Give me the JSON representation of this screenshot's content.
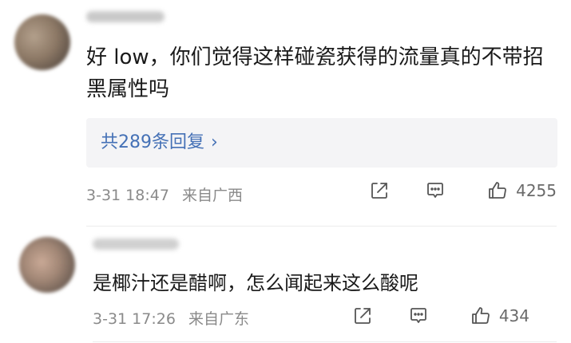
{
  "comments": [
    {
      "text": "好 low，你们觉得这样碰瓷获得的流量真的不带招黑属性吗",
      "reply_link": "共289条回复",
      "timestamp": "3-31 18:47",
      "location": "来自广西",
      "likes": "4255"
    },
    {
      "text": "是椰汁还是醋啊，怎么闻起来这么酸呢",
      "timestamp": "3-31 17:26",
      "location": "来自广东",
      "likes": "434"
    }
  ],
  "icons": {
    "share": "share-icon",
    "comment": "comment-icon",
    "like": "thumbs-up-icon",
    "reply_chevron": "chevron-right-icon"
  },
  "colors": {
    "link": "#4571b6",
    "meta": "#8a8a8a",
    "reply_bg": "#f4f4f6"
  }
}
